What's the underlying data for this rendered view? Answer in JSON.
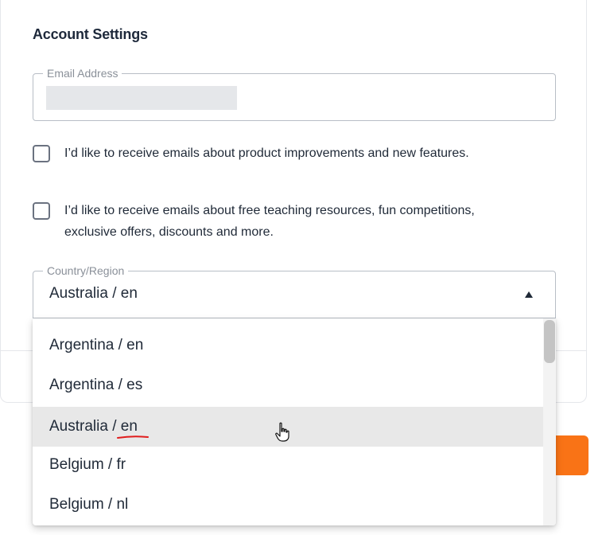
{
  "page": {
    "title": "Account Settings"
  },
  "email": {
    "legend": "Email Address",
    "value": ""
  },
  "preferences": [
    {
      "label": "I’d like to receive emails about product improvements and new features.",
      "checked": false
    },
    {
      "label": "I’d like to receive emails about free teaching resources, fun competitions, exclusive offers, discounts and more.",
      "checked": false
    }
  ],
  "country": {
    "legend": "Country/Region",
    "selected": "Australia / en",
    "options": [
      {
        "label": "Argentina / en"
      },
      {
        "label": "Argentina / es"
      },
      {
        "label": "Australia / en",
        "highlighted": true
      },
      {
        "label": "Belgium / fr"
      },
      {
        "label": "Belgium / nl"
      }
    ]
  },
  "colors": {
    "accent": "#f97316",
    "highlight": "#e8e8e8",
    "annotation": "#e11d1d"
  },
  "icons": {
    "caret": "caret-up-icon",
    "cursor": "hand-pointer-icon"
  }
}
